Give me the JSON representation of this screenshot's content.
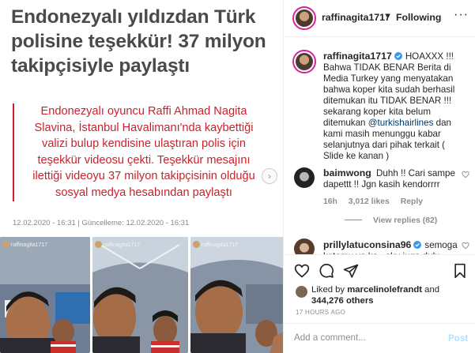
{
  "article": {
    "headline": "Endonezyalı yıldızdan Türk polisine teşekkür! 37 milyon takipçisiyle paylaştı",
    "summary": "Endonezyalı oyuncu Raffi Ahmad Nagita Slavina, İstanbul Havalimanı'nda kaybettiği valizi bulup kendisine ulaştıran polis için teşekkür videosu çekti. Teşekkür mesajını ilettiği videoyu 37 milyon takipçisinin olduğu sosyal medya hesabından paylaştı",
    "dates": "12.02.2020 - 16:31 | Güncelleme: 12.02.2020 - 16:31",
    "video_captions": [
      "raffinagita1717",
      "raffinagita1717",
      "raffinagita1717"
    ]
  },
  "header": {
    "username": "raffinagita1717",
    "separator": "•",
    "follow_label": "Following",
    "more_label": "···"
  },
  "caption": {
    "username": "raffinagita1717",
    "text_before_tag": "HOAXXX !!! Bahwa TIDAK BENAR Berita di Media Turkey yang menyatakan bahwa koper kita sudah berhasil ditemukan itu TIDAK BENAR !!! sekarang koper kita belum ditemukan",
    "tag": "@turkishairlines",
    "text_after_tag": "dan kami masih menunggu kabar selanjutnya dari pihak terkait ( Slide ke kanan )"
  },
  "comments": [
    {
      "username": "baimwong",
      "text": "Duhh !! Cari sampe dapettt !! Jgn kasih kendorrrr",
      "time": "16h",
      "likes": "3,012 likes",
      "reply_label": "Reply",
      "view_replies": "View replies (82)"
    },
    {
      "username": "prillylatuconsina96",
      "text": "semoga ketemu ya ka.. aku juga dulu"
    }
  ],
  "actions": {
    "liked_by_prefix": "Liked by",
    "liked_by_user": "marcelinolefrandt",
    "liked_by_and": "and",
    "liked_count": "344,276 others",
    "time_ago": "17 HOURS AGO"
  },
  "add_comment": {
    "placeholder": "Add a comment...",
    "post_label": "Post"
  },
  "icons": {
    "heart": "heart-icon",
    "comment": "comment-icon",
    "share": "share-icon",
    "save": "bookmark-icon",
    "verified": "verified-badge-icon"
  },
  "colors": {
    "headline": "#4a4a4a",
    "summary_red": "#c8232c",
    "link_blue": "#00376b",
    "verified_blue": "#3897f0",
    "post_button": "#b2dffc"
  }
}
